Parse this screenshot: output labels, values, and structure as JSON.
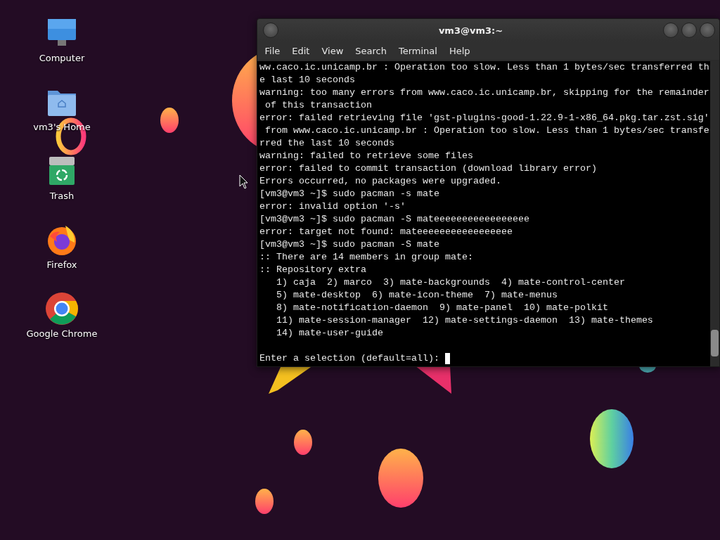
{
  "desktop_icons": [
    {
      "label": "Computer"
    },
    {
      "label": "vm3's Home"
    },
    {
      "label": "Trash"
    },
    {
      "label": "Firefox"
    },
    {
      "label": "Google Chrome"
    }
  ],
  "terminal": {
    "title": "vm3@vm3:~",
    "menu": [
      "File",
      "Edit",
      "View",
      "Search",
      "Terminal",
      "Help"
    ],
    "lines": [
      "ww.caco.ic.unicamp.br : Operation too slow. Less than 1 bytes/sec transferred th",
      "e last 10 seconds",
      "warning: too many errors from www.caco.ic.unicamp.br, skipping for the remainder",
      " of this transaction",
      "error: failed retrieving file 'gst-plugins-good-1.22.9-1-x86_64.pkg.tar.zst.sig'",
      " from www.caco.ic.unicamp.br : Operation too slow. Less than 1 bytes/sec transfe",
      "rred the last 10 seconds",
      "warning: failed to retrieve some files",
      "error: failed to commit transaction (download library error)",
      "Errors occurred, no packages were upgraded.",
      "[vm3@vm3 ~]$ sudo pacman -s mate",
      "error: invalid option '-s'",
      "[vm3@vm3 ~]$ sudo pacman -S mateeeeeeeeeeeeeeeee",
      "error: target not found: mateeeeeeeeeeeeeeeee",
      "[vm3@vm3 ~]$ sudo pacman -S mate",
      ":: There are 14 members in group mate:",
      ":: Repository extra",
      "   1) caja  2) marco  3) mate-backgrounds  4) mate-control-center",
      "   5) mate-desktop  6) mate-icon-theme  7) mate-menus",
      "   8) mate-notification-daemon  9) mate-panel  10) mate-polkit",
      "   11) mate-session-manager  12) mate-settings-daemon  13) mate-themes",
      "   14) mate-user-guide"
    ],
    "prompt": "Enter a selection (default=all): "
  }
}
